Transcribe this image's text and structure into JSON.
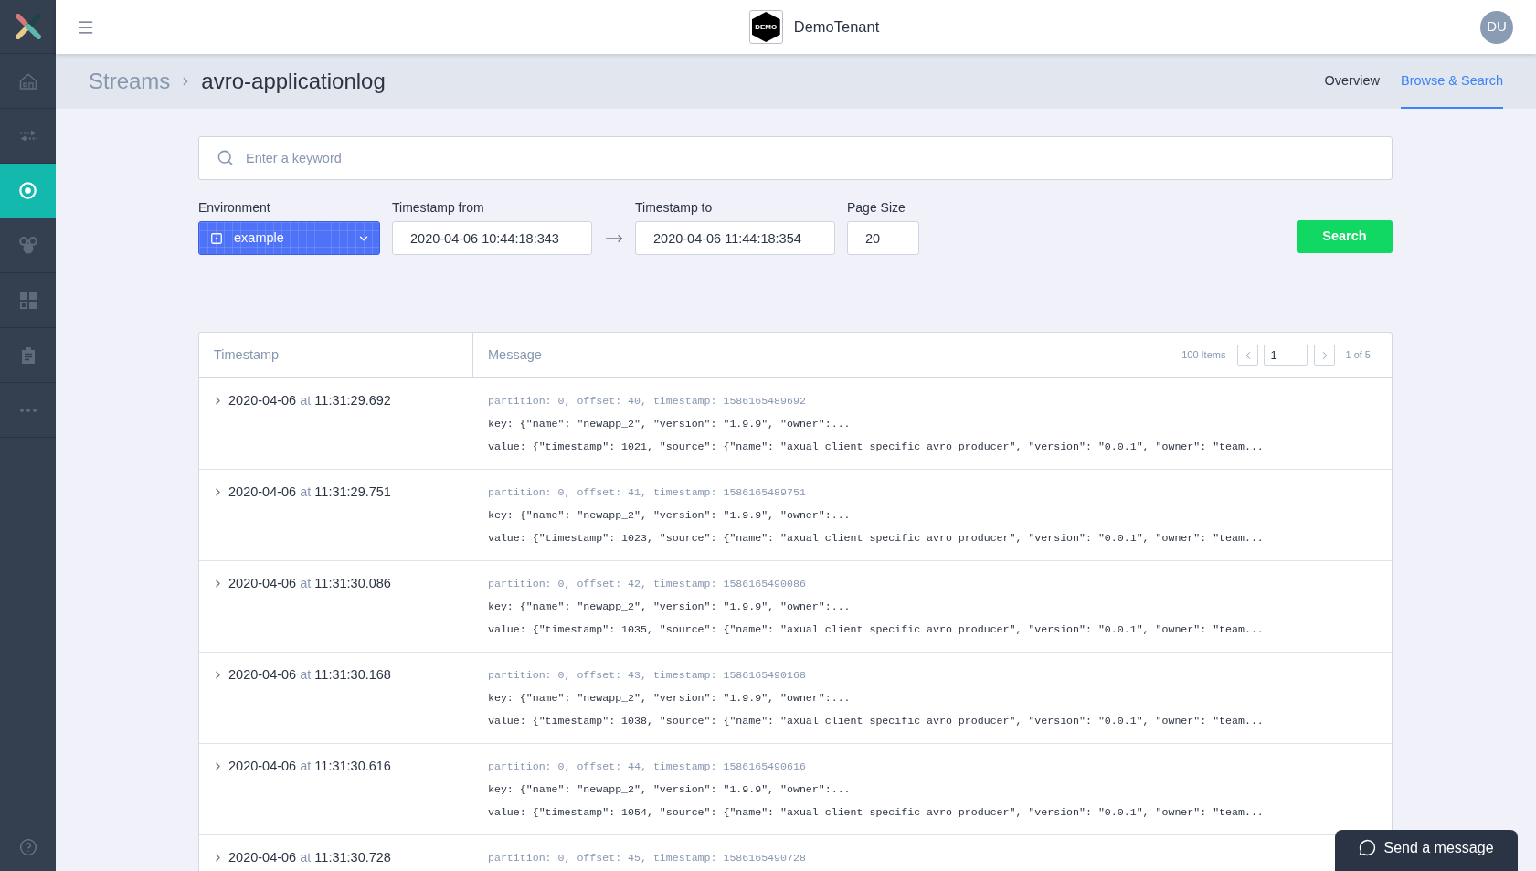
{
  "sidebar": {
    "items": [
      {
        "kind": "home",
        "selected": false
      },
      {
        "kind": "transfer",
        "selected": false
      },
      {
        "kind": "target",
        "selected": true
      },
      {
        "kind": "network",
        "selected": false
      },
      {
        "kind": "grid",
        "selected": false
      },
      {
        "kind": "clipboard",
        "selected": false
      },
      {
        "kind": "more",
        "selected": false
      }
    ]
  },
  "header": {
    "tenant_badge": "DEMO",
    "tenant_name": "DemoTenant",
    "avatar": "DU"
  },
  "breadcrumb": {
    "parent": "Streams",
    "current": "avro-applicationlog"
  },
  "tabs": [
    {
      "label": "Overview",
      "selected": false
    },
    {
      "label": "Browse & Search",
      "selected": true
    }
  ],
  "search": {
    "placeholder": "Enter a keyword"
  },
  "filters": {
    "environment": {
      "label": "Environment",
      "value": "example"
    },
    "timestamp_from": {
      "label": "Timestamp from",
      "value": "2020-04-06 10:44:18:343"
    },
    "timestamp_to": {
      "label": "Timestamp to",
      "value": "2020-04-06 11:44:18:354"
    },
    "page_size": {
      "label": "Page Size",
      "value": "20"
    },
    "search_button": "Search"
  },
  "table": {
    "columns": [
      "Timestamp",
      "Message"
    ],
    "pagination": {
      "total": "100 Items",
      "page": "1",
      "page_count": "1 of 5"
    },
    "rows": [
      {
        "expanded": false,
        "date": "2020-04-06",
        "at": "at",
        "time": "11:31:29.692",
        "meta": "partition: 0, offset: 40, timestamp: 1586165489692",
        "key": "key: {\"name\": \"newapp_2\", \"version\": \"1.9.9\", \"owner\":...",
        "value": "value: {\"timestamp\": 1021, \"source\": {\"name\": \"axual client specific avro producer\", \"version\": \"0.0.1\", \"owner\": \"team..."
      },
      {
        "expanded": false,
        "date": "2020-04-06",
        "at": "at",
        "time": "11:31:29.751",
        "meta": "partition: 0, offset: 41, timestamp: 1586165489751",
        "key": "key: {\"name\": \"newapp_2\", \"version\": \"1.9.9\", \"owner\":...",
        "value": "value: {\"timestamp\": 1023, \"source\": {\"name\": \"axual client specific avro producer\", \"version\": \"0.0.1\", \"owner\": \"team..."
      },
      {
        "expanded": false,
        "date": "2020-04-06",
        "at": "at",
        "time": "11:31:30.086",
        "meta": "partition: 0, offset: 42, timestamp: 1586165490086",
        "key": "key: {\"name\": \"newapp_2\", \"version\": \"1.9.9\", \"owner\":...",
        "value": "value: {\"timestamp\": 1035, \"source\": {\"name\": \"axual client specific avro producer\", \"version\": \"0.0.1\", \"owner\": \"team..."
      },
      {
        "expanded": false,
        "date": "2020-04-06",
        "at": "at",
        "time": "11:31:30.168",
        "meta": "partition: 0, offset: 43, timestamp: 1586165490168",
        "key": "key: {\"name\": \"newapp_2\", \"version\": \"1.9.9\", \"owner\":...",
        "value": "value: {\"timestamp\": 1038, \"source\": {\"name\": \"axual client specific avro producer\", \"version\": \"0.0.1\", \"owner\": \"team..."
      },
      {
        "expanded": false,
        "date": "2020-04-06",
        "at": "at",
        "time": "11:31:30.616",
        "meta": "partition: 0, offset: 44, timestamp: 1586165490616",
        "key": "key: {\"name\": \"newapp_2\", \"version\": \"1.9.9\", \"owner\":...",
        "value": "value: {\"timestamp\": 1054, \"source\": {\"name\": \"axual client specific avro producer\", \"version\": \"0.0.1\", \"owner\": \"team..."
      },
      {
        "expanded": false,
        "date": "2020-04-06",
        "at": "at",
        "time": "11:31:30.728",
        "meta": "partition: 0, offset: 45, timestamp: 1586165490728"
      }
    ]
  },
  "chat_button": "Send a message"
}
